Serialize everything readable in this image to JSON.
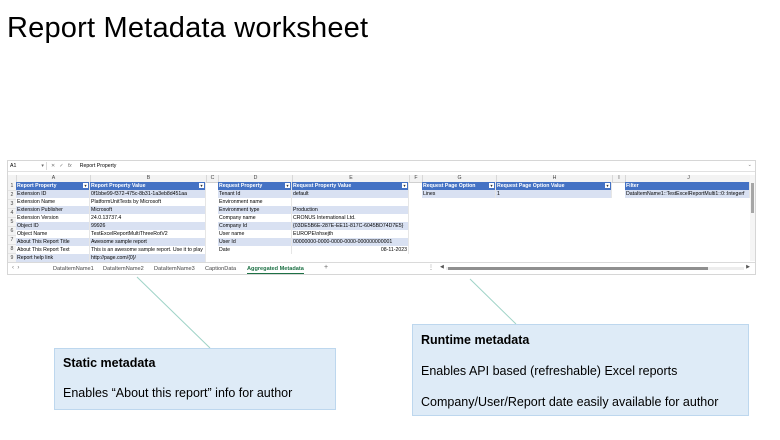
{
  "slide": {
    "title": "Report Metadata worksheet"
  },
  "excel": {
    "formula_bar": {
      "cell_ref": "A1",
      "fx": "fx",
      "cancel": "✕",
      "enter": "✓",
      "content": "Report Property"
    },
    "columns": [
      "A",
      "B",
      "C",
      "D",
      "E",
      "F",
      "G",
      "H",
      "I",
      "J"
    ],
    "rows": [
      "1",
      "2",
      "3",
      "4",
      "5",
      "6",
      "7",
      "8",
      "9",
      "10"
    ],
    "static_table": {
      "headers": [
        "Report Property",
        "Report Property Value"
      ],
      "rows": [
        [
          "Extension ID",
          "0f1bbe99-f372-475c-8b31-1a3eb8d451aa"
        ],
        [
          "Extension Name",
          "PlatformUnitTests by Microsoft"
        ],
        [
          "Extension Publisher",
          "Microsoft"
        ],
        [
          "Extension Version",
          "24.0.13737.4"
        ],
        [
          "Object ID",
          "99926"
        ],
        [
          "Object Name",
          "TestExcelReportMultiThreeRotV2"
        ],
        [
          "About This Report Title",
          "Awesome sample report"
        ],
        [
          "About This Report Text",
          "This is an awesome sample report. Use it to play"
        ],
        [
          "Report help link",
          "http://page.com/{0}/"
        ]
      ]
    },
    "request_table": {
      "headers": [
        "Request Property",
        "Request Property Value"
      ],
      "rows": [
        [
          "Tenant Id",
          "default"
        ],
        [
          "Environment name",
          ""
        ],
        [
          "Environment type",
          "Production"
        ],
        [
          "Company name",
          "CRONUS International Ltd."
        ],
        [
          "Company Id",
          "{03DE5B6E-287E-EE11-817C-6045BD74D7E5}"
        ],
        [
          "User name",
          "EUROPE\\nhsejth"
        ],
        [
          "User Id",
          "00000000-0000-0000-0000-000000000001"
        ],
        [
          "Date",
          "08-11-2023"
        ]
      ]
    },
    "page_table": {
      "headers": [
        "Request Page Option",
        "Request Page Option Value"
      ],
      "rows": [
        [
          "Lines",
          "1"
        ]
      ]
    },
    "filter_table": {
      "headers": [
        "Filter"
      ],
      "rows": [
        [
          "DataItemName1::TestExcelReportMulti1::0::Integerf"
        ]
      ]
    },
    "sheet_tabs": [
      "DataItemName1",
      "DataItemName2",
      "DataItemName3",
      "CaptionData",
      "Aggregated Metadata"
    ],
    "active_tab": "Aggregated Metadata",
    "nav": {
      "prev": "‹",
      "next": "›",
      "add": "+",
      "more": "⋮"
    }
  },
  "callouts": {
    "static": {
      "title": "Static metadata",
      "body": "Enables “About this report” info for author"
    },
    "runtime": {
      "title": "Runtime metadata",
      "body1": "Enables API based (refreshable) Excel reports",
      "body2": "Company/User/Report date easily available for author"
    }
  },
  "colors": {
    "header_blue": "#4472c4",
    "band_blue": "#d9e1f2",
    "callout_fill": "#deebf7",
    "callout_border": "#bdd7ee",
    "active_tab_green": "#1e7145"
  }
}
